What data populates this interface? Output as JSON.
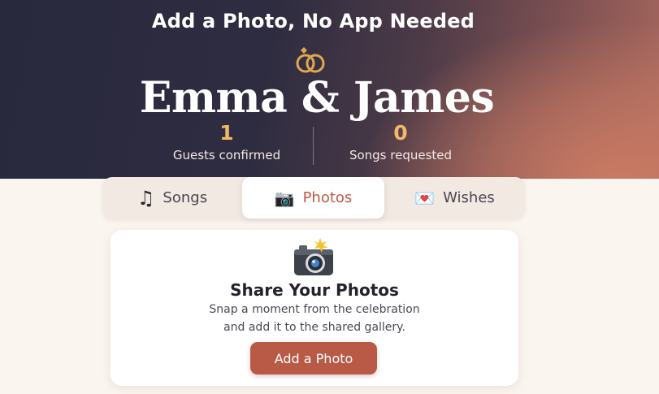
{
  "hero": {
    "headline": "Add a Photo, No App Needed",
    "couple_names": "Emma & James",
    "icon": "wedding-rings-icon",
    "stats": [
      {
        "value": "1",
        "label": "Guests confirmed"
      },
      {
        "value": "0",
        "label": "Songs requested"
      }
    ]
  },
  "tabs": [
    {
      "label": "Songs",
      "icon": "music-note-icon",
      "glyph": "♫",
      "active": false
    },
    {
      "label": "Photos",
      "icon": "camera-icon",
      "glyph": "📷",
      "active": true
    },
    {
      "label": "Wishes",
      "icon": "love-letter-icon",
      "glyph": "💌",
      "active": false
    }
  ],
  "photos_card": {
    "icon": "camera-flash-icon",
    "title": "Share Your Photos",
    "description_line1": "Snap a moment from the celebration",
    "description_line2": "and add it to the shared gallery.",
    "button_label": "Add a Photo"
  },
  "colors": {
    "accent": "#b95a47",
    "active_tab_text": "#c05a47",
    "stat_number": "#f0b867",
    "page_background": "#fbf5f0"
  }
}
